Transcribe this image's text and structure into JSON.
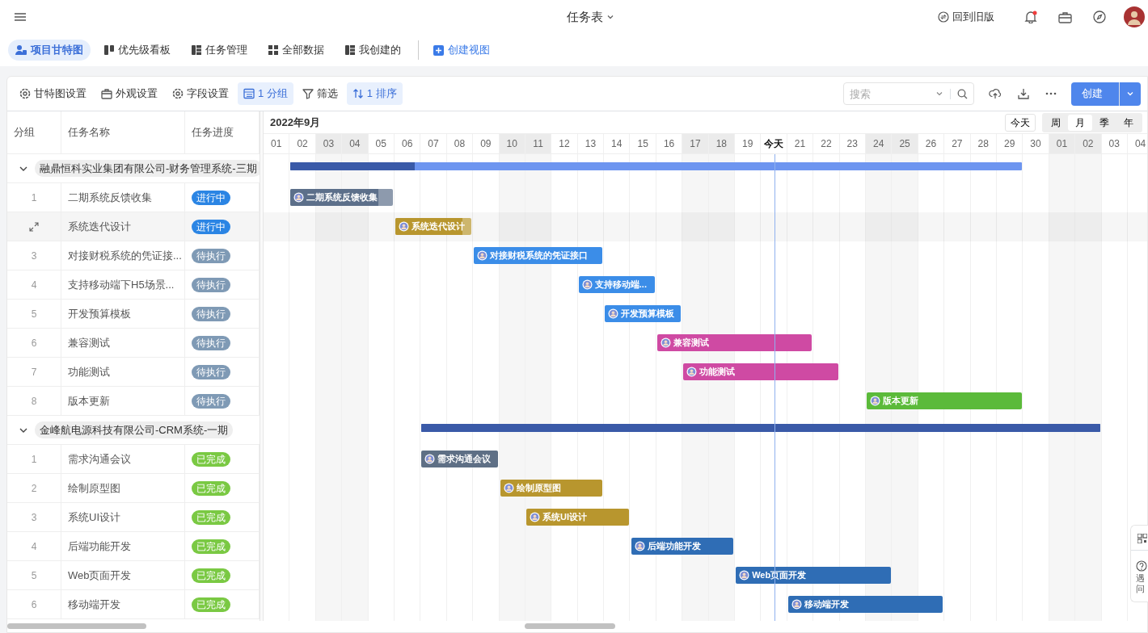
{
  "topbar": {
    "title": "任务表",
    "old_version": "回到旧版",
    "notifications_unread": true
  },
  "view_tabs": [
    {
      "label": "项目甘特图",
      "selected": true
    },
    {
      "label": "优先级看板",
      "selected": false
    },
    {
      "label": "任务管理",
      "selected": false
    },
    {
      "label": "全部数据",
      "selected": false
    },
    {
      "label": "我创建的",
      "selected": false
    }
  ],
  "create_view": "创建视图",
  "toolbar": [
    {
      "label": "甘特图设置",
      "active": false
    },
    {
      "label": "外观设置",
      "active": false
    },
    {
      "label": "字段设置",
      "active": false
    },
    {
      "label": "1 分组",
      "active": true
    },
    {
      "label": "筛选",
      "active": false
    },
    {
      "label": "1 排序",
      "active": true
    }
  ],
  "search": {
    "placeholder": "搜索"
  },
  "create_button": "创建",
  "columns": [
    "分组",
    "任务名称",
    "任务进度"
  ],
  "gantt": {
    "month_label": "2022年9月",
    "today_button": "今天",
    "scale_options": [
      {
        "label": "周",
        "selected": false
      },
      {
        "label": "月",
        "selected": true
      },
      {
        "label": "季",
        "selected": false
      },
      {
        "label": "年",
        "selected": false
      }
    ],
    "days": [
      {
        "label": "01",
        "weekend": false,
        "today": false
      },
      {
        "label": "02",
        "weekend": false,
        "today": false
      },
      {
        "label": "03",
        "weekend": true,
        "today": false
      },
      {
        "label": "04",
        "weekend": true,
        "today": false
      },
      {
        "label": "05",
        "weekend": false,
        "today": false
      },
      {
        "label": "06",
        "weekend": false,
        "today": false
      },
      {
        "label": "07",
        "weekend": false,
        "today": false
      },
      {
        "label": "08",
        "weekend": false,
        "today": false
      },
      {
        "label": "09",
        "weekend": false,
        "today": false
      },
      {
        "label": "10",
        "weekend": true,
        "today": false
      },
      {
        "label": "11",
        "weekend": true,
        "today": false
      },
      {
        "label": "12",
        "weekend": false,
        "today": false
      },
      {
        "label": "13",
        "weekend": false,
        "today": false
      },
      {
        "label": "14",
        "weekend": false,
        "today": false
      },
      {
        "label": "15",
        "weekend": false,
        "today": false
      },
      {
        "label": "16",
        "weekend": false,
        "today": false
      },
      {
        "label": "17",
        "weekend": true,
        "today": false
      },
      {
        "label": "18",
        "weekend": true,
        "today": false
      },
      {
        "label": "19",
        "weekend": false,
        "today": false
      },
      {
        "label": "今天",
        "weekend": false,
        "today": true
      },
      {
        "label": "21",
        "weekend": false,
        "today": false
      },
      {
        "label": "22",
        "weekend": false,
        "today": false
      },
      {
        "label": "23",
        "weekend": false,
        "today": false
      },
      {
        "label": "24",
        "weekend": true,
        "today": false
      },
      {
        "label": "25",
        "weekend": true,
        "today": false
      },
      {
        "label": "26",
        "weekend": false,
        "today": false
      },
      {
        "label": "27",
        "weekend": false,
        "today": false
      },
      {
        "label": "28",
        "weekend": false,
        "today": false
      },
      {
        "label": "29",
        "weekend": false,
        "today": false
      },
      {
        "label": "30",
        "weekend": false,
        "today": false
      },
      {
        "label": "01",
        "weekend": true,
        "today": false
      },
      {
        "label": "02",
        "weekend": true,
        "today": false
      },
      {
        "label": "03",
        "weekend": false,
        "today": false
      },
      {
        "label": "04",
        "weekend": false,
        "today": false
      }
    ]
  },
  "groups": [
    {
      "name": "融鼎恒科实业集团有限公司-财务管理系统-三期",
      "expanded": true,
      "bar": {
        "level": 0.17
      },
      "tasks": [
        {
          "index": "1",
          "name": "二期系统反馈收集",
          "status": {
            "label": "进行中",
            "color": "#2b85e4"
          },
          "hovered": false,
          "color": "#5c6f8a",
          "bar_label": "二期系统反馈收集",
          "level": 0.86
        },
        {
          "name": "系统迭代设计",
          "status": {
            "label": "进行中",
            "color": "#2b85e4"
          },
          "hovered": true,
          "color": "#b8962e",
          "bar_label": "系统迭代设计",
          "level": 0.88
        },
        {
          "index": "3",
          "name": "对接财税系统的凭证接...",
          "status": {
            "label": "待执行",
            "color": "#7f9ab5"
          },
          "hovered": false,
          "color": "#3b8de8",
          "bar_label": "对接财税系统的凭证接口"
        },
        {
          "index": "4",
          "name": "支持移动端下H5场景...",
          "status": {
            "label": "待执行",
            "color": "#7f9ab5"
          },
          "hovered": false,
          "color": "#3b8de8",
          "bar_label": "支持移动端..."
        },
        {
          "index": "5",
          "name": "开发预算模板",
          "status": {
            "label": "待执行",
            "color": "#7f9ab5"
          },
          "hovered": false,
          "color": "#3b8de8",
          "bar_label": "开发预算模板"
        },
        {
          "index": "6",
          "name": "兼容测试",
          "status": {
            "label": "待执行",
            "color": "#7f9ab5"
          },
          "hovered": false,
          "color": "#cf4aa3",
          "bar_label": "兼容测试"
        },
        {
          "index": "7",
          "name": "功能测试",
          "status": {
            "label": "待执行",
            "color": "#7f9ab5"
          },
          "hovered": false,
          "color": "#cf4aa3",
          "bar_label": "功能测试"
        },
        {
          "index": "8",
          "name": "版本更新",
          "status": {
            "label": "待执行",
            "color": "#7f9ab5"
          },
          "hovered": false,
          "color": "#5bba3a",
          "bar_label": "版本更新"
        }
      ]
    },
    {
      "name": "金峰航电源科技有限公司-CRM系统-一期",
      "expanded": true,
      "bar": {
        "level": 1
      },
      "tasks": [
        {
          "index": "1",
          "name": "需求沟通会议",
          "status": {
            "label": "已完成",
            "color": "#7ac943"
          },
          "hovered": false,
          "color": "#5e6f85",
          "bar_label": "需求沟通会议"
        },
        {
          "index": "2",
          "name": "绘制原型图",
          "status": {
            "label": "已完成",
            "color": "#7ac943"
          },
          "hovered": false,
          "color": "#b8962e",
          "bar_label": "绘制原型图"
        },
        {
          "index": "3",
          "name": "系统UI设计",
          "status": {
            "label": "已完成",
            "color": "#7ac943"
          },
          "hovered": false,
          "color": "#b8962e",
          "bar_label": "系统UI设计"
        },
        {
          "index": "4",
          "name": "后端功能开发",
          "status": {
            "label": "已完成",
            "color": "#7ac943"
          },
          "hovered": false,
          "color": "#2f6db5",
          "bar_label": "后端功能开发"
        },
        {
          "index": "5",
          "name": "Web页面开发",
          "status": {
            "label": "已完成",
            "color": "#7ac943"
          },
          "hovered": false,
          "color": "#2f6db5",
          "bar_label": "Web页面开发"
        },
        {
          "index": "6",
          "name": "移动端开发",
          "status": {
            "label": "已完成",
            "color": "#7ac943"
          },
          "hovered": false,
          "color": "#2f6db5",
          "bar_label": "移动端开发"
        }
      ]
    }
  ],
  "help_widget": {
    "lines": [
      "遇",
      "问"
    ]
  }
}
